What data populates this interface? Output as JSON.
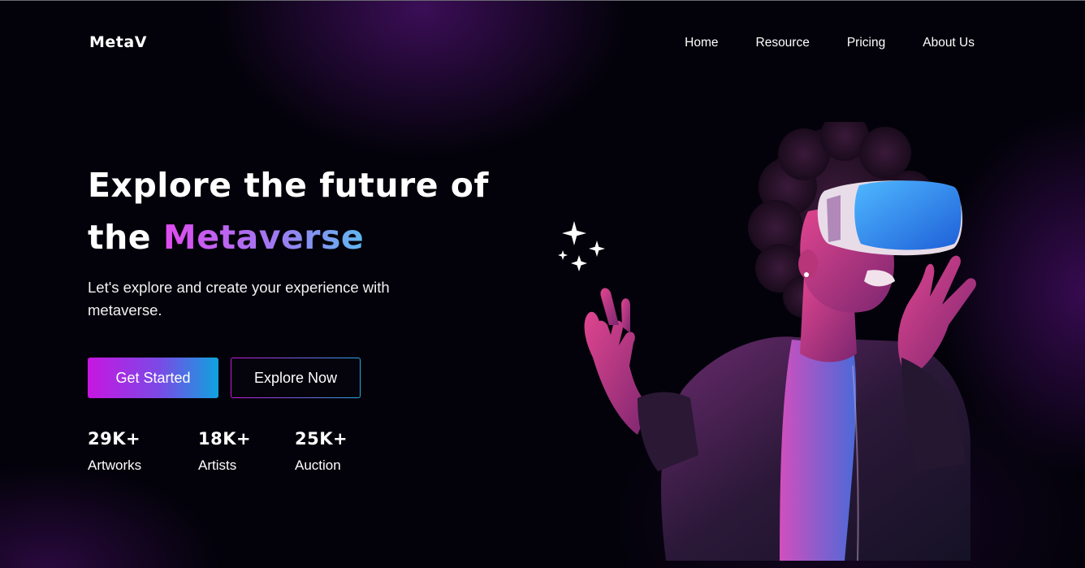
{
  "brand": {
    "logo": "MetaV"
  },
  "nav": {
    "items": [
      "Home",
      "Resource",
      "Pricing",
      "About Us"
    ]
  },
  "hero": {
    "headline_line1": "Explore the future of",
    "headline_prefix": "the",
    "headline_highlight": "Metaverse",
    "subtitle": "Let's explore and create your experience with metaverse.",
    "primary_button": "Get Started",
    "secondary_button": "Explore Now"
  },
  "stats": [
    {
      "value": "29K+",
      "label": "Artworks"
    },
    {
      "value": "18K+",
      "label": "Artists"
    },
    {
      "value": "25K+",
      "label": "Auction"
    }
  ],
  "icons": [
    "sparkles-icon"
  ],
  "colors": {
    "background": "#03020a",
    "accent_magenta": "#c716e0",
    "accent_blue": "#0fa3df",
    "headline_gradient": [
      "#e04bf0",
      "#a078f0",
      "#5fb8f0"
    ]
  }
}
